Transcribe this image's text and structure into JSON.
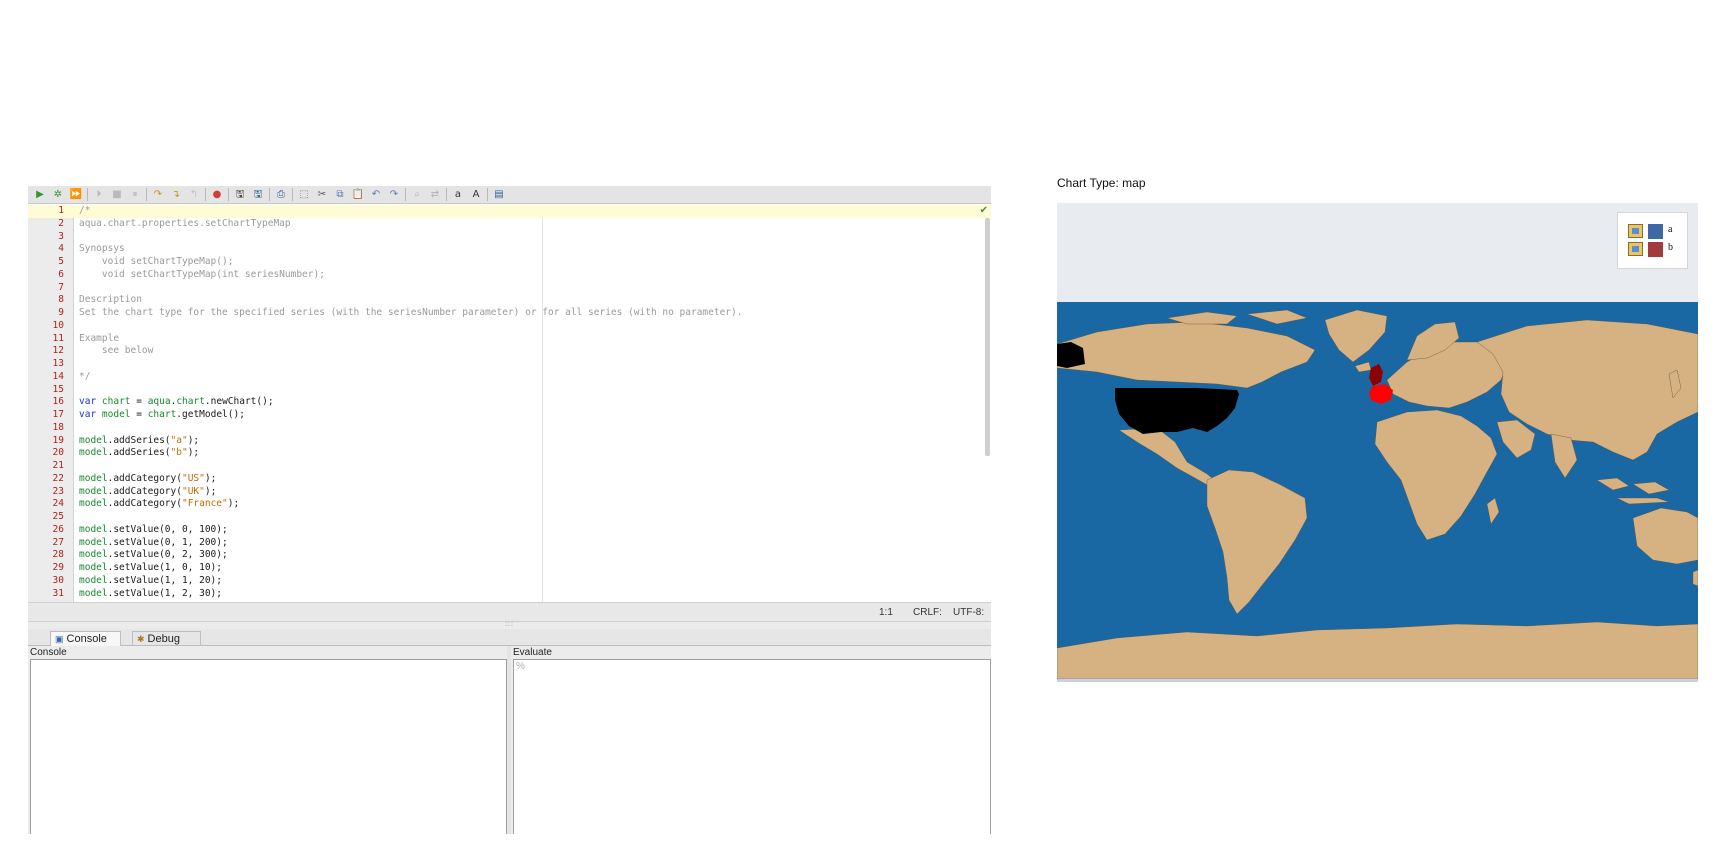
{
  "editor": {
    "toolbar_icons": [
      "run-icon",
      "debug-icon",
      "run-all-icon",
      "sep",
      "step-icon",
      "stop-icon",
      "pause-icon",
      "sep",
      "step-over-icon",
      "step-into-icon",
      "step-out-icon",
      "sep",
      "breakpoint-icon",
      "sep",
      "save-icon",
      "save-as-icon",
      "sep",
      "print-icon",
      "sep",
      "select-all-icon",
      "cut-icon",
      "copy-icon",
      "paste-icon",
      "undo-icon",
      "redo-icon",
      "sep",
      "find-icon",
      "replace-icon",
      "sep",
      "font-smaller-icon",
      "font-larger-icon",
      "sep",
      "outline-icon"
    ],
    "lines": [
      {
        "n": "1",
        "t": "/*",
        "k": "cm"
      },
      {
        "n": "2",
        "t": "aqua.chart.properties.setChartTypeMap",
        "k": "cm"
      },
      {
        "n": "3",
        "t": "",
        "k": "cm"
      },
      {
        "n": "4",
        "t": "Synopsys",
        "k": "cm"
      },
      {
        "n": "5",
        "t": "    void setChartTypeMap();",
        "k": "cm"
      },
      {
        "n": "6",
        "t": "    void setChartTypeMap(int seriesNumber);",
        "k": "cm"
      },
      {
        "n": "7",
        "t": "",
        "k": "cm"
      },
      {
        "n": "8",
        "t": "Description",
        "k": "cm"
      },
      {
        "n": "9",
        "t": "Set the chart type for the specified series (with the seriesNumber parameter) or for all series (with no parameter).",
        "k": "cm"
      },
      {
        "n": "10",
        "t": "",
        "k": "cm"
      },
      {
        "n": "11",
        "t": "Example",
        "k": "cm"
      },
      {
        "n": "12",
        "t": "    see below",
        "k": "cm"
      },
      {
        "n": "13",
        "t": "",
        "k": "cm"
      },
      {
        "n": "14",
        "t": "*/",
        "k": "cm"
      },
      {
        "n": "15",
        "t": "",
        "k": "code"
      },
      {
        "n": "16",
        "t": "var chart = aqua.chart.newChart();",
        "k": "code"
      },
      {
        "n": "17",
        "t": "var model = chart.getModel();",
        "k": "code"
      },
      {
        "n": "18",
        "t": "",
        "k": "code"
      },
      {
        "n": "19",
        "t": "model.addSeries(\"a\");",
        "k": "code"
      },
      {
        "n": "20",
        "t": "model.addSeries(\"b\");",
        "k": "code"
      },
      {
        "n": "21",
        "t": "",
        "k": "code"
      },
      {
        "n": "22",
        "t": "model.addCategory(\"US\");",
        "k": "code"
      },
      {
        "n": "23",
        "t": "model.addCategory(\"UK\");",
        "k": "code"
      },
      {
        "n": "24",
        "t": "model.addCategory(\"France\");",
        "k": "code"
      },
      {
        "n": "25",
        "t": "",
        "k": "code"
      },
      {
        "n": "26",
        "t": "model.setValue(0, 0, 100);",
        "k": "code"
      },
      {
        "n": "27",
        "t": "model.setValue(0, 1, 200);",
        "k": "code"
      },
      {
        "n": "28",
        "t": "model.setValue(0, 2, 300);",
        "k": "code"
      },
      {
        "n": "29",
        "t": "model.setValue(1, 0, 10);",
        "k": "code"
      },
      {
        "n": "30",
        "t": "model.setValue(1, 1, 20);",
        "k": "code"
      },
      {
        "n": "31",
        "t": "model.setValue(1, 2, 30);",
        "k": "code"
      }
    ],
    "status": {
      "position": "1:1",
      "line_ending": "CRLF:",
      "encoding": "UTF-8:"
    },
    "splitter_grip": ":::",
    "tabs": [
      {
        "label": "Console",
        "icon": "console-icon",
        "active": true
      },
      {
        "label": "Debug",
        "icon": "debug-icon",
        "active": false
      }
    ],
    "console_label": "Console",
    "evaluate_label": "Evaluate",
    "evaluate_placeholder": "%"
  },
  "chart": {
    "title_label": "Chart Type: map",
    "colors": {
      "background": "#e8ecf1",
      "ocean": "#1a68a3",
      "land": "#d6b282",
      "series_a": "#3c68a8",
      "series_b": "#a23b3b"
    },
    "legend": [
      {
        "name": "a",
        "color": "#3c68a8"
      },
      {
        "name": "b",
        "color": "#a23b3b"
      }
    ],
    "highlighted_regions": [
      {
        "region": "US",
        "color": "#000000"
      },
      {
        "region": "UK",
        "color": "#8b0000"
      },
      {
        "region": "France",
        "color": "#ff0000"
      }
    ]
  }
}
